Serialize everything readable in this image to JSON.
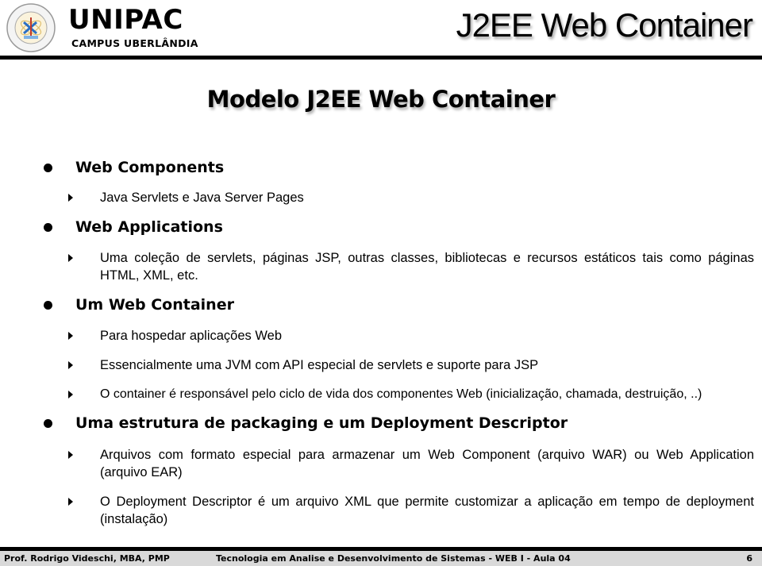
{
  "header": {
    "brand_name": "UNIPAC",
    "brand_sub": "CAMPUS UBERLÂNDIA",
    "seal_icon": "university-seal-icon",
    "title": "J2EE Web Container"
  },
  "slide": {
    "title": "Modelo J2EE Web Container",
    "bullets": [
      {
        "text": "Web Components",
        "sub": [
          "Java Servlets e Java Server Pages"
        ]
      },
      {
        "text": "Web Applications",
        "sub": [
          "Uma coleção de servlets, páginas JSP, outras classes, bibliotecas e recursos estáticos tais como páginas HTML, XML, etc."
        ]
      },
      {
        "text": "Um Web Container",
        "sub": [
          "Para hospedar aplicações Web",
          "Essencialmente uma JVM com API especial de servlets e suporte para JSP",
          "O container é responsável pelo ciclo de vida dos componentes Web (inicialização, chamada, destruição, ..)"
        ]
      },
      {
        "text": "Uma estrutura de packaging e um Deployment Descriptor",
        "sub": [
          "Arquivos com formato especial para armazenar um Web Component (arquivo WAR) ou Web Application (arquivo EAR)",
          "O Deployment Descriptor é um arquivo XML que permite customizar a aplicação em tempo de deployment (instalação)"
        ]
      }
    ]
  },
  "footer": {
    "author": "Prof. Rodrigo Videschi, MBA, PMP",
    "course": "Tecnologia em Analise e Desenvolvimento de Sistemas - WEB I - Aula 04",
    "page": "6"
  }
}
